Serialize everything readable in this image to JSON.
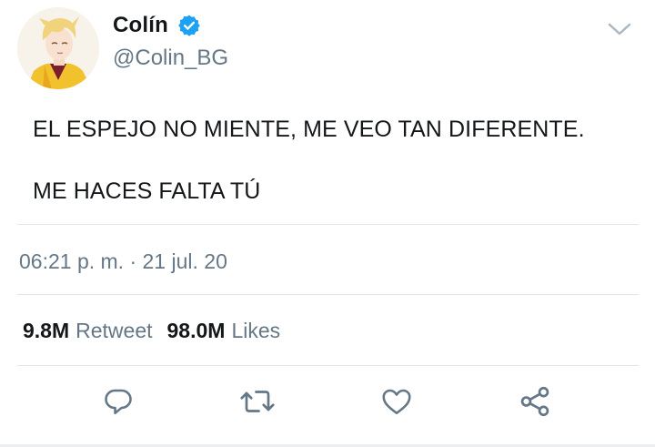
{
  "user": {
    "display_name": "Colín",
    "handle": "@Colin_BG",
    "verified": true,
    "avatar_icon": "cartoon-blond-character-avatar"
  },
  "tweet": {
    "lines": [
      "EL ESPEJO NO MIENTE, ME VEO TAN DIFERENTE.",
      "ME HACES FALTA TÚ"
    ],
    "timestamp": "06:21 p. m. · 21 jul. 20"
  },
  "stats": {
    "retweets_count": "9.8M",
    "retweets_label": "Retweet",
    "likes_count": "98.0M",
    "likes_label": "Likes"
  },
  "actions": {
    "reply_icon": "reply-icon",
    "retweet_icon": "retweet-icon",
    "like_icon": "heart-icon",
    "share_icon": "share-icon"
  },
  "colors": {
    "text_primary": "#14171a",
    "text_secondary": "#657786",
    "verified_blue": "#1da1f2",
    "divider": "#e1e8ed"
  }
}
